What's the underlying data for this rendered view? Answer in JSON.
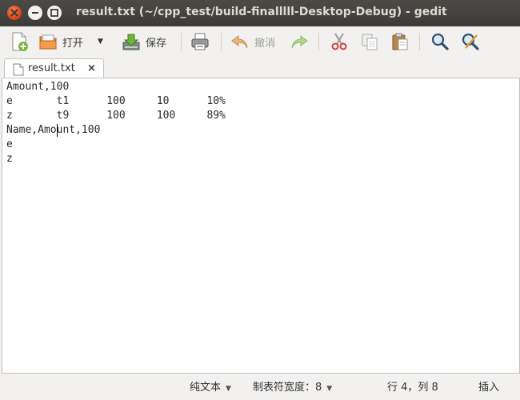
{
  "window": {
    "title": "result.txt (~/cpp_test/build-finalllll-Desktop-Debug) - gedit"
  },
  "toolbar": {
    "new_icon": "new-document-icon",
    "open_label": "打开",
    "open_icon": "open-folder-icon",
    "save_label": "保存",
    "save_icon": "save-icon",
    "print_icon": "printer-icon",
    "undo_label": "撤消",
    "undo_icon": "undo-icon",
    "redo_icon": "redo-icon",
    "cut_icon": "scissors-icon",
    "copy_icon": "copy-icon",
    "paste_icon": "paste-icon",
    "find_icon": "search-icon",
    "replace_icon": "find-replace-icon"
  },
  "tab": {
    "label": "result.txt",
    "close": "×"
  },
  "editor": {
    "lines": [
      "Amount,100",
      "e       t1      100     10      10%",
      "z       t9      100     100     89%",
      "Name,Amount,100",
      "e",
      "z"
    ]
  },
  "statusbar": {
    "syntax": "纯文本",
    "tab_width": "制表符宽度：8",
    "position": "行 4，列 8",
    "mode": "插入"
  },
  "colors": {
    "titlebar": "#3c3b37",
    "close_button": "#dd4814",
    "title_text": "#dfdbd2"
  }
}
